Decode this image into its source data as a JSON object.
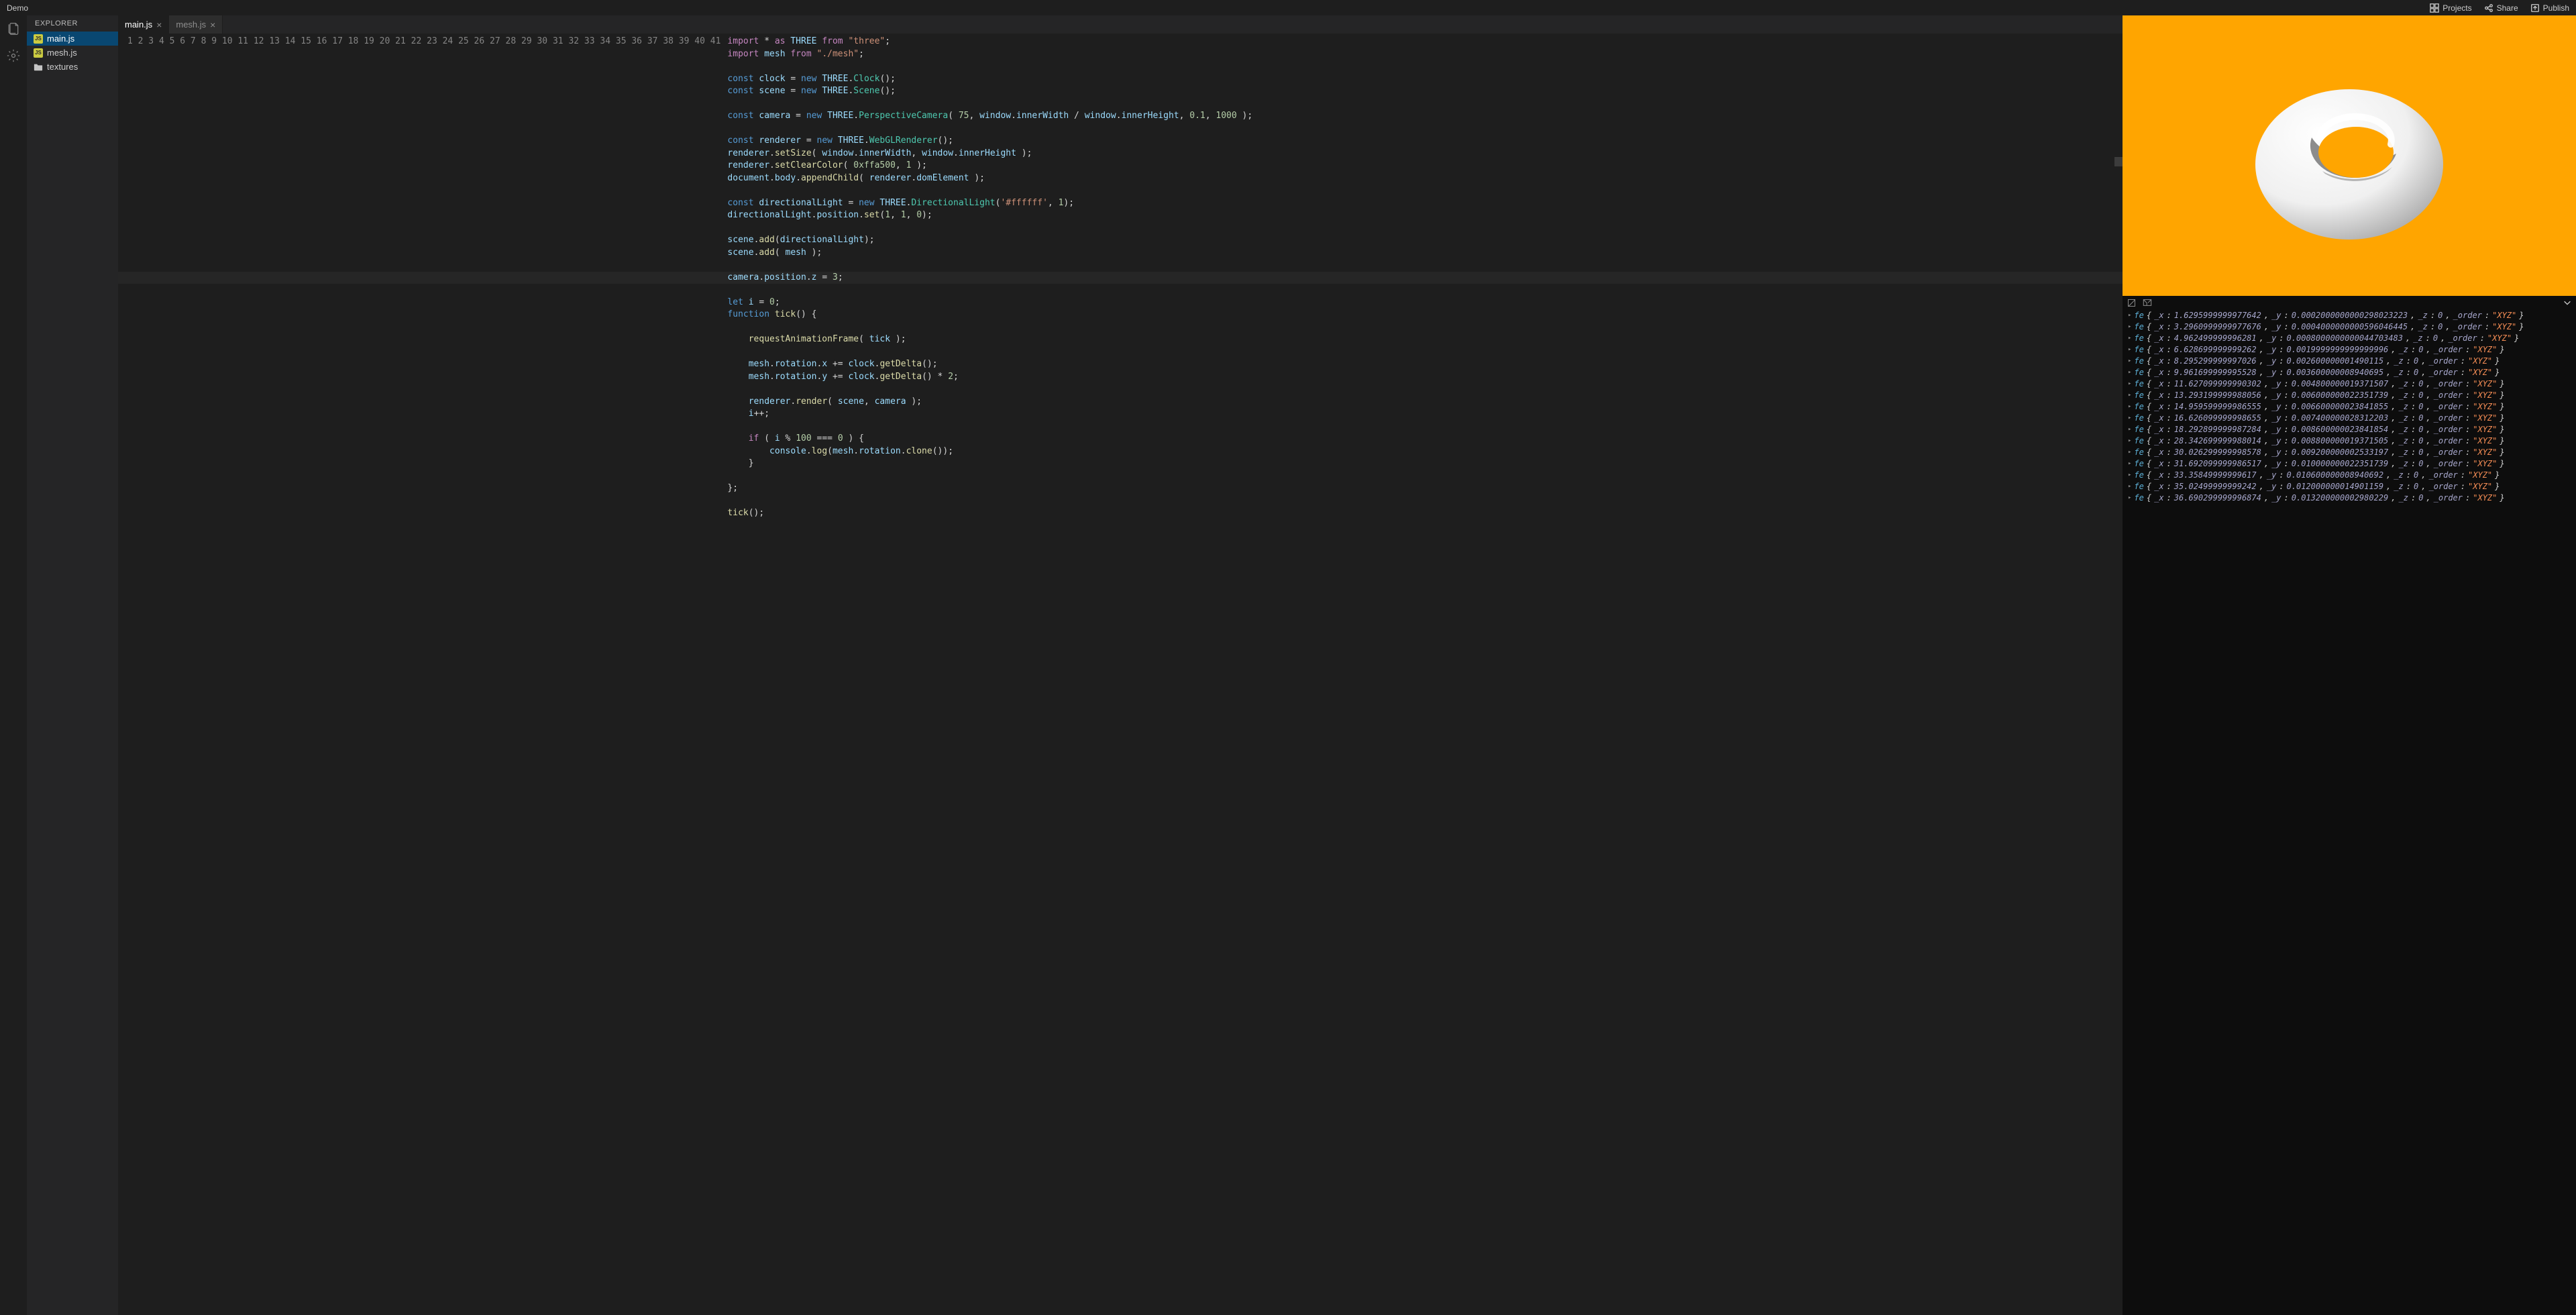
{
  "header": {
    "title": "Demo",
    "buttons": {
      "projects": "Projects",
      "share": "Share",
      "publish": "Publish"
    }
  },
  "sidebar": {
    "title": "EXPLORER",
    "files": [
      {
        "name": "main.js",
        "type": "js",
        "active": true
      },
      {
        "name": "mesh.js",
        "type": "js",
        "active": false
      },
      {
        "name": "textures",
        "type": "folder",
        "active": false
      }
    ]
  },
  "tabs": [
    {
      "label": "main.js",
      "active": true
    },
    {
      "label": "mesh.js",
      "active": false
    }
  ],
  "editor": {
    "lineCount": 41,
    "highlightedLine": 20
  },
  "code_lines": [
    [
      [
        "kw",
        "import"
      ],
      [
        "op",
        " * "
      ],
      [
        "kw",
        "as"
      ],
      [
        "op",
        " "
      ],
      [
        "var",
        "THREE"
      ],
      [
        "op",
        " "
      ],
      [
        "kw",
        "from"
      ],
      [
        "op",
        " "
      ],
      [
        "str",
        "\"three\""
      ],
      [
        "punc",
        ";"
      ]
    ],
    [
      [
        "kw",
        "import"
      ],
      [
        "op",
        " "
      ],
      [
        "var",
        "mesh"
      ],
      [
        "op",
        " "
      ],
      [
        "kw",
        "from"
      ],
      [
        "op",
        " "
      ],
      [
        "str",
        "\"./mesh\""
      ],
      [
        "punc",
        ";"
      ]
    ],
    [],
    [
      [
        "decl",
        "const"
      ],
      [
        "op",
        " "
      ],
      [
        "var",
        "clock"
      ],
      [
        "op",
        " = "
      ],
      [
        "decl",
        "new"
      ],
      [
        "op",
        " "
      ],
      [
        "var",
        "THREE"
      ],
      [
        "punc",
        "."
      ],
      [
        "type",
        "Clock"
      ],
      [
        "punc",
        "();"
      ]
    ],
    [
      [
        "decl",
        "const"
      ],
      [
        "op",
        " "
      ],
      [
        "var",
        "scene"
      ],
      [
        "op",
        " = "
      ],
      [
        "decl",
        "new"
      ],
      [
        "op",
        " "
      ],
      [
        "var",
        "THREE"
      ],
      [
        "punc",
        "."
      ],
      [
        "type",
        "Scene"
      ],
      [
        "punc",
        "();"
      ]
    ],
    [],
    [
      [
        "decl",
        "const"
      ],
      [
        "op",
        " "
      ],
      [
        "var",
        "camera"
      ],
      [
        "op",
        " = "
      ],
      [
        "decl",
        "new"
      ],
      [
        "op",
        " "
      ],
      [
        "var",
        "THREE"
      ],
      [
        "punc",
        "."
      ],
      [
        "type",
        "PerspectiveCamera"
      ],
      [
        "punc",
        "( "
      ],
      [
        "num",
        "75"
      ],
      [
        "punc",
        ", "
      ],
      [
        "var",
        "window"
      ],
      [
        "punc",
        "."
      ],
      [
        "var",
        "innerWidth"
      ],
      [
        "op",
        " / "
      ],
      [
        "var",
        "window"
      ],
      [
        "punc",
        "."
      ],
      [
        "var",
        "innerHeight"
      ],
      [
        "punc",
        ", "
      ],
      [
        "num",
        "0.1"
      ],
      [
        "punc",
        ", "
      ],
      [
        "num",
        "1000"
      ],
      [
        "punc",
        " );"
      ]
    ],
    [],
    [
      [
        "decl",
        "const"
      ],
      [
        "op",
        " "
      ],
      [
        "var",
        "renderer"
      ],
      [
        "op",
        " = "
      ],
      [
        "decl",
        "new"
      ],
      [
        "op",
        " "
      ],
      [
        "var",
        "THREE"
      ],
      [
        "punc",
        "."
      ],
      [
        "type",
        "WebGLRenderer"
      ],
      [
        "punc",
        "();"
      ]
    ],
    [
      [
        "var",
        "renderer"
      ],
      [
        "punc",
        "."
      ],
      [
        "fn",
        "setSize"
      ],
      [
        "punc",
        "( "
      ],
      [
        "var",
        "window"
      ],
      [
        "punc",
        "."
      ],
      [
        "var",
        "innerWidth"
      ],
      [
        "punc",
        ", "
      ],
      [
        "var",
        "window"
      ],
      [
        "punc",
        "."
      ],
      [
        "var",
        "innerHeight"
      ],
      [
        "punc",
        " );"
      ]
    ],
    [
      [
        "var",
        "renderer"
      ],
      [
        "punc",
        "."
      ],
      [
        "fn",
        "setClearColor"
      ],
      [
        "punc",
        "( "
      ],
      [
        "num",
        "0xffa500"
      ],
      [
        "punc",
        ", "
      ],
      [
        "num",
        "1"
      ],
      [
        "punc",
        " );"
      ]
    ],
    [
      [
        "var",
        "document"
      ],
      [
        "punc",
        "."
      ],
      [
        "var",
        "body"
      ],
      [
        "punc",
        "."
      ],
      [
        "fn",
        "appendChild"
      ],
      [
        "punc",
        "( "
      ],
      [
        "var",
        "renderer"
      ],
      [
        "punc",
        "."
      ],
      [
        "var",
        "domElement"
      ],
      [
        "punc",
        " );"
      ]
    ],
    [],
    [
      [
        "decl",
        "const"
      ],
      [
        "op",
        " "
      ],
      [
        "var",
        "directionalLight"
      ],
      [
        "op",
        " = "
      ],
      [
        "decl",
        "new"
      ],
      [
        "op",
        " "
      ],
      [
        "var",
        "THREE"
      ],
      [
        "punc",
        "."
      ],
      [
        "type",
        "DirectionalLight"
      ],
      [
        "punc",
        "("
      ],
      [
        "str",
        "'#ffffff'"
      ],
      [
        "punc",
        ", "
      ],
      [
        "num",
        "1"
      ],
      [
        "punc",
        ");"
      ]
    ],
    [
      [
        "var",
        "directionalLight"
      ],
      [
        "punc",
        "."
      ],
      [
        "var",
        "position"
      ],
      [
        "punc",
        "."
      ],
      [
        "fn",
        "set"
      ],
      [
        "punc",
        "("
      ],
      [
        "num",
        "1"
      ],
      [
        "punc",
        ", "
      ],
      [
        "num",
        "1"
      ],
      [
        "punc",
        ", "
      ],
      [
        "num",
        "0"
      ],
      [
        "punc",
        ");"
      ]
    ],
    [],
    [
      [
        "var",
        "scene"
      ],
      [
        "punc",
        "."
      ],
      [
        "fn",
        "add"
      ],
      [
        "punc",
        "("
      ],
      [
        "var",
        "directionalLight"
      ],
      [
        "punc",
        ");"
      ]
    ],
    [
      [
        "var",
        "scene"
      ],
      [
        "punc",
        "."
      ],
      [
        "fn",
        "add"
      ],
      [
        "punc",
        "( "
      ],
      [
        "var",
        "mesh"
      ],
      [
        "punc",
        " );"
      ]
    ],
    [],
    [
      [
        "var",
        "camera"
      ],
      [
        "punc",
        "."
      ],
      [
        "var",
        "position"
      ],
      [
        "punc",
        "."
      ],
      [
        "var",
        "z"
      ],
      [
        "op",
        " = "
      ],
      [
        "num",
        "3"
      ],
      [
        "punc",
        ";"
      ]
    ],
    [],
    [
      [
        "decl",
        "let"
      ],
      [
        "op",
        " "
      ],
      [
        "var",
        "i"
      ],
      [
        "op",
        " = "
      ],
      [
        "num",
        "0"
      ],
      [
        "punc",
        ";"
      ]
    ],
    [
      [
        "decl",
        "function"
      ],
      [
        "op",
        " "
      ],
      [
        "fn",
        "tick"
      ],
      [
        "punc",
        "() {"
      ]
    ],
    [],
    [
      [
        "op",
        "    "
      ],
      [
        "fn",
        "requestAnimationFrame"
      ],
      [
        "punc",
        "( "
      ],
      [
        "var",
        "tick"
      ],
      [
        "punc",
        " );"
      ]
    ],
    [],
    [
      [
        "op",
        "    "
      ],
      [
        "var",
        "mesh"
      ],
      [
        "punc",
        "."
      ],
      [
        "var",
        "rotation"
      ],
      [
        "punc",
        "."
      ],
      [
        "var",
        "x"
      ],
      [
        "op",
        " += "
      ],
      [
        "var",
        "clock"
      ],
      [
        "punc",
        "."
      ],
      [
        "fn",
        "getDelta"
      ],
      [
        "punc",
        "();"
      ]
    ],
    [
      [
        "op",
        "    "
      ],
      [
        "var",
        "mesh"
      ],
      [
        "punc",
        "."
      ],
      [
        "var",
        "rotation"
      ],
      [
        "punc",
        "."
      ],
      [
        "var",
        "y"
      ],
      [
        "op",
        " += "
      ],
      [
        "var",
        "clock"
      ],
      [
        "punc",
        "."
      ],
      [
        "fn",
        "getDelta"
      ],
      [
        "punc",
        "() * "
      ],
      [
        "num",
        "2"
      ],
      [
        "punc",
        ";"
      ]
    ],
    [],
    [
      [
        "op",
        "    "
      ],
      [
        "var",
        "renderer"
      ],
      [
        "punc",
        "."
      ],
      [
        "fn",
        "render"
      ],
      [
        "punc",
        "( "
      ],
      [
        "var",
        "scene"
      ],
      [
        "punc",
        ", "
      ],
      [
        "var",
        "camera"
      ],
      [
        "punc",
        " );"
      ]
    ],
    [
      [
        "op",
        "    "
      ],
      [
        "var",
        "i"
      ],
      [
        "op",
        "++"
      ],
      [
        "punc",
        ";"
      ]
    ],
    [],
    [
      [
        "op",
        "    "
      ],
      [
        "kw",
        "if"
      ],
      [
        "punc",
        " ( "
      ],
      [
        "var",
        "i"
      ],
      [
        "op",
        " % "
      ],
      [
        "num",
        "100"
      ],
      [
        "op",
        " === "
      ],
      [
        "num",
        "0"
      ],
      [
        "punc",
        " ) {"
      ]
    ],
    [
      [
        "op",
        "        "
      ],
      [
        "var",
        "console"
      ],
      [
        "punc",
        "."
      ],
      [
        "fn",
        "log"
      ],
      [
        "punc",
        "("
      ],
      [
        "var",
        "mesh"
      ],
      [
        "punc",
        "."
      ],
      [
        "var",
        "rotation"
      ],
      [
        "punc",
        "."
      ],
      [
        "fn",
        "clone"
      ],
      [
        "punc",
        "());"
      ]
    ],
    [
      [
        "op",
        "    "
      ],
      [
        "punc",
        "}"
      ]
    ],
    [],
    [
      [
        "punc",
        "};"
      ]
    ],
    [],
    [
      [
        "fn",
        "tick"
      ],
      [
        "punc",
        "();"
      ]
    ],
    [],
    []
  ],
  "console": [
    {
      "x": "1.6295999999977642",
      "y": "0.0002000000000298023223",
      "z": "0",
      "order": "\"XYZ\""
    },
    {
      "x": "3.2960999999977676",
      "y": "0.0004000000000596046445",
      "z": "0",
      "order": "\"XYZ\""
    },
    {
      "x": "4.962499999996281",
      "y": "0.0008000000000044703483",
      "z": "0",
      "order": "\"XYZ\""
    },
    {
      "x": "6.628699999999262",
      "y": "0.0019999999999999996",
      "z": "0",
      "order": "\"XYZ\""
    },
    {
      "x": "8.295299999997026",
      "y": "0.002600000001490115",
      "z": "0",
      "order": "\"XYZ\""
    },
    {
      "x": "9.961699999995528",
      "y": "0.003600000008940695",
      "z": "0",
      "order": "\"XYZ\""
    },
    {
      "x": "11.627099999990302",
      "y": "0.004800000019371507",
      "z": "0",
      "order": "\"XYZ\""
    },
    {
      "x": "13.293199999988056",
      "y": "0.006000000022351739",
      "z": "0",
      "order": "\"XYZ\""
    },
    {
      "x": "14.959599999986555",
      "y": "0.006600000023841855",
      "z": "0",
      "order": "\"XYZ\""
    },
    {
      "x": "16.626099999998655",
      "y": "0.007400000028312203",
      "z": "0",
      "order": "\"XYZ\""
    },
    {
      "x": "18.292899999987284",
      "y": "0.008600000023841854",
      "z": "0",
      "order": "\"XYZ\""
    },
    {
      "x": "28.342699999988014",
      "y": "0.008800000019371505",
      "z": "0",
      "order": "\"XYZ\""
    },
    {
      "x": "30.026299999998578",
      "y": "0.009200000002533197",
      "z": "0",
      "order": "\"XYZ\""
    },
    {
      "x": "31.692099999986517",
      "y": "0.010000000022351739",
      "z": "0",
      "order": "\"XYZ\""
    },
    {
      "x": "33.35849999999617",
      "y": "0.010600000008940692",
      "z": "0",
      "order": "\"XYZ\""
    },
    {
      "x": "35.02499999999242",
      "y": "0.012000000014901159",
      "z": "0",
      "order": "\"XYZ\""
    },
    {
      "x": "36.690299999996874",
      "y": "0.013200000002980229",
      "z": "0",
      "order": "\"XYZ\""
    }
  ]
}
